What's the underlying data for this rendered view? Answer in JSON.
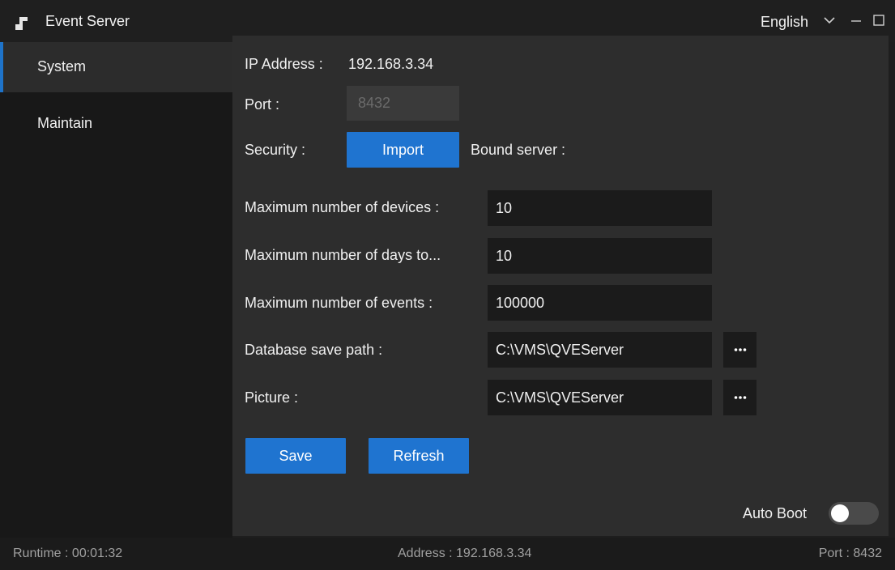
{
  "titlebar": {
    "title": "Event Server",
    "language": "English"
  },
  "icons": {
    "app": "app-logo-icon",
    "language_dropdown": "chevron-down-icon",
    "minimize": "minimize-icon",
    "maximize": "maximize-icon",
    "browse": "more-dots-icon"
  },
  "sidebar": {
    "items": [
      {
        "label": "System",
        "active": true
      },
      {
        "label": "Maintain",
        "active": false
      }
    ]
  },
  "form": {
    "ip_label": "IP Address :",
    "ip_value": "192.168.3.34",
    "port_label": "Port :",
    "port_value": "8432",
    "security_label": "Security :",
    "import_button": "Import",
    "bound_server_label": "Bound server :",
    "max_devices_label": "Maximum number of devices :",
    "max_devices_value": "10",
    "max_days_label": "Maximum number of days to...",
    "max_days_value": "10",
    "max_events_label": "Maximum number of events :",
    "max_events_value": "100000",
    "db_path_label": "Database save path :",
    "db_path_value": "C:\\VMS\\QVEServer",
    "picture_label": "Picture :",
    "picture_value": "C:\\VMS\\QVEServer",
    "save_button": "Save",
    "refresh_button": "Refresh",
    "auto_boot_label": "Auto Boot",
    "auto_boot_on": false
  },
  "statusbar": {
    "runtime": "Runtime :  00:01:32",
    "address": "Address :  192.168.3.34",
    "port": "Port :  8432"
  },
  "colors": {
    "accent": "#1f74d0",
    "background": "#1e1e1e",
    "panel": "#2d2d2d",
    "input": "#1b1b1b"
  }
}
